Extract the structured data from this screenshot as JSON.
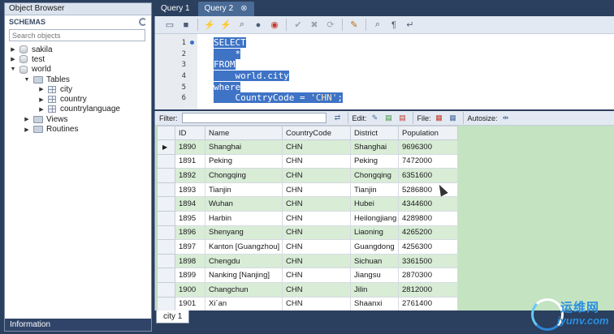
{
  "object_browser": {
    "title": "Object Browser",
    "schemas_label": "SCHEMAS",
    "search_placeholder": "Search objects",
    "tree": {
      "sakila": "sakila",
      "test": "test",
      "world": "world",
      "tables": "Tables",
      "city": "city",
      "country": "country",
      "countrylanguage": "countrylanguage",
      "views": "Views",
      "routines": "Routines"
    },
    "info_label": "Information"
  },
  "tabs": {
    "query1": "Query 1",
    "query2": "Query 2",
    "close": "⊗"
  },
  "editor": {
    "line_numbers": [
      "1",
      "2",
      "3",
      "4",
      "5",
      "6"
    ],
    "lines": {
      "l1": "SELECT",
      "l2": "    *",
      "l3": "FROM",
      "l4": "    world.city",
      "l5": "where",
      "l6a": "    CountryCode = ",
      "l6b": "'CHN'",
      "l6c": ";"
    }
  },
  "result_toolbar": {
    "filter_label": "Filter:",
    "edit_label": "Edit:",
    "file_label": "File:",
    "autosize_label": "Autosize:"
  },
  "grid": {
    "headers": [
      "ID",
      "Name",
      "CountryCode",
      "District",
      "Population"
    ],
    "rows": [
      [
        "1890",
        "Shanghai",
        "CHN",
        "Shanghai",
        "9696300"
      ],
      [
        "1891",
        "Peking",
        "CHN",
        "Peking",
        "7472000"
      ],
      [
        "1892",
        "Chongqing",
        "CHN",
        "Chongqing",
        "6351600"
      ],
      [
        "1893",
        "Tianjin",
        "CHN",
        "Tianjin",
        "5286800"
      ],
      [
        "1894",
        "Wuhan",
        "CHN",
        "Hubei",
        "4344600"
      ],
      [
        "1895",
        "Harbin",
        "CHN",
        "Heilongjiang",
        "4289800"
      ],
      [
        "1896",
        "Shenyang",
        "CHN",
        "Liaoning",
        "4265200"
      ],
      [
        "1897",
        "Kanton [Guangzhou]",
        "CHN",
        "Guangdong",
        "4256300"
      ],
      [
        "1898",
        "Chengdu",
        "CHN",
        "Sichuan",
        "3361500"
      ],
      [
        "1899",
        "Nanking [Nanjing]",
        "CHN",
        "Jiangsu",
        "2870300"
      ],
      [
        "1900",
        "Changchun",
        "CHN",
        "Jilin",
        "2812000"
      ],
      [
        "1901",
        "Xi´an",
        "CHN",
        "Shaanxi",
        "2761400"
      ]
    ],
    "current_row_marker": "▶"
  },
  "result_tab": "city 1",
  "watermark": {
    "cn": "运维网",
    "en": "iyunv.com"
  },
  "icons": {
    "expand": "▶",
    "collapse": "▼"
  }
}
